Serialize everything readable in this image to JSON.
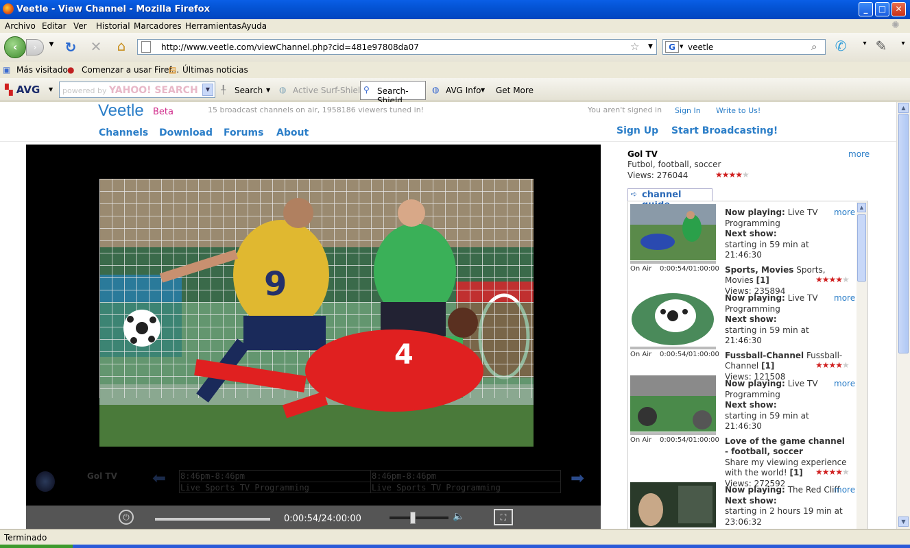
{
  "window": {
    "title": "Veetle - View Channel - Mozilla Firefox",
    "min": "_",
    "max": "□",
    "close": "✕"
  },
  "menu": [
    "Archivo",
    "Editar",
    "Ver",
    "Historial",
    "Marcadores",
    "Herramientas",
    "Ayuda"
  ],
  "nav": {
    "url": "http://www.veetle.com/viewChannel.php?cid=481e97808da07",
    "search_value": "veetle"
  },
  "bookmarks": [
    "Más visitados",
    "Comenzar a usar Firef...",
    "Últimas noticias"
  ],
  "avg": {
    "logo": "AVG",
    "search_placeholder": "powered by",
    "yahoo": "YAHOO! SEARCH",
    "search_label": "Search",
    "active_surf": "Active Surf-Shield",
    "search_shield": "Search-Shield",
    "avg_info": "AVG Info",
    "get_more": "Get More"
  },
  "site": {
    "logo": "Veetle",
    "beta": "Beta",
    "tagline": "15 broadcast channels on air, 1958186 viewers tuned in!",
    "not_signed": "You aren't signed in",
    "sign_in": "Sign In",
    "write_to_us": "Write to Us!",
    "nav": [
      "Channels",
      "Download",
      "Forums",
      "About"
    ],
    "sign_up": "Sign Up",
    "start_broadcasting": "Start Broadcasting!"
  },
  "player": {
    "channel_name": "Gol TV",
    "guide_cells": [
      "8:46pm-8:46pm",
      "8:46pm-8:46pm",
      "Live Sports TV Programming",
      "Live Sports TV Programming"
    ],
    "time": "0:00:54/24:00:00",
    "progress": 0.0,
    "volume": 0.4
  },
  "channel": {
    "title": "Gol TV",
    "tags": "Futbol, football, soccer",
    "views": "Views: 276044",
    "rating": 4,
    "more": "more"
  },
  "guide": {
    "tab": "channel guide",
    "items": [
      {
        "now_label": "Now playing:",
        "now": "Live TV Programming",
        "next_label": "Next show:",
        "next": "starting in 59 min at 21:46:30",
        "name": "Sports, Movies",
        "desc": "Sports, Movies",
        "count": "[1]",
        "views": "Views: 235894",
        "rating": 4,
        "on_air": "On Air",
        "time": "0:00:54/01:00:00",
        "more": "more"
      },
      {
        "now_label": "Now playing:",
        "now": "Live TV Programming",
        "next_label": "Next show:",
        "next": "starting in 59 min at 21:46:30",
        "name": "Fussball-Channel",
        "desc": "Fussball-Channel",
        "count": "[1]",
        "views": "Views: 121508",
        "rating": 4,
        "on_air": "On Air",
        "time": "0:00:54/01:00:00",
        "more": "more"
      },
      {
        "now_label": "Now playing:",
        "now": "Live TV Programming",
        "next_label": "Next show:",
        "next": "starting in 59 min at 21:46:30",
        "name": "Love of the game channel - football, soccer",
        "desc": "Share my viewing experience with the world!",
        "count": "[1]",
        "views": "Views: 272592",
        "rating": 4,
        "on_air": "On Air",
        "time": "0:00:54/01:00:00",
        "more": "more"
      },
      {
        "now_label": "Now playing:",
        "now": "The Red Cliff",
        "next_label": "Next show:",
        "next": "starting in 2 hours 19 min at 23:06:32",
        "more": "more"
      }
    ]
  },
  "status": "Terminado"
}
